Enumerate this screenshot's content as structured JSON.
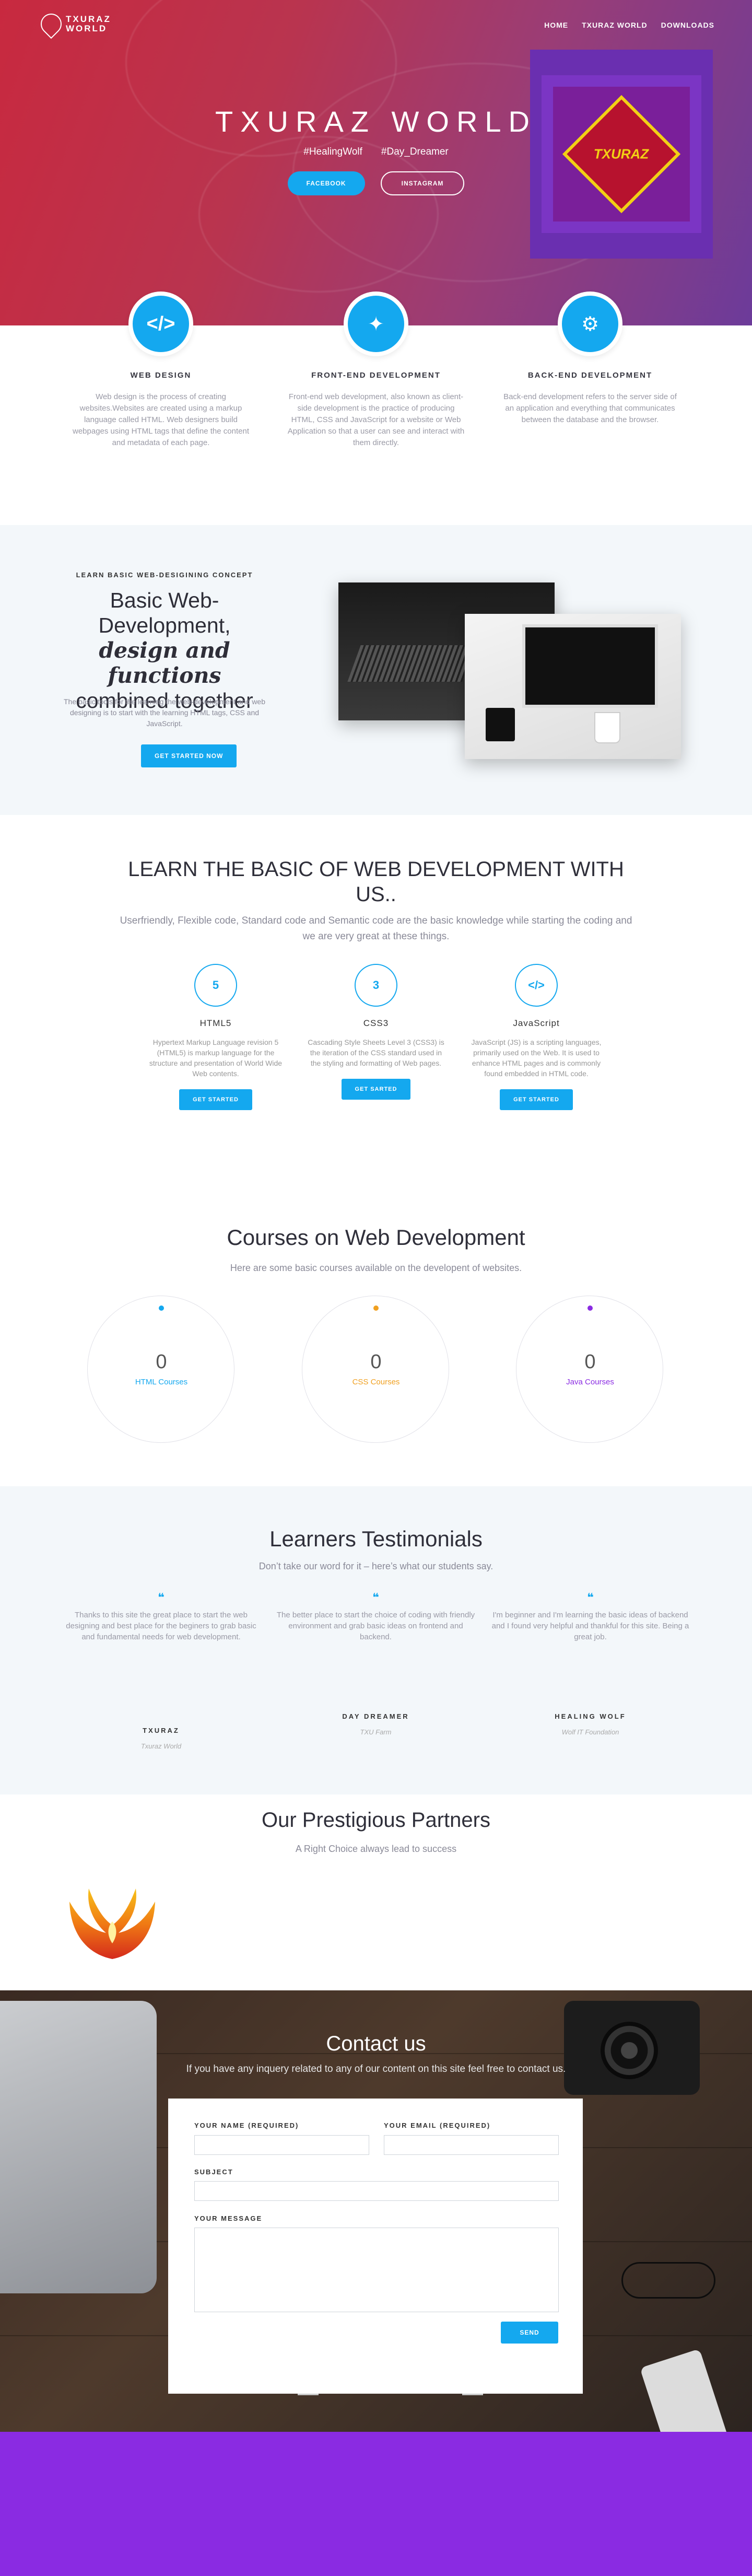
{
  "brand": {
    "name_line1": "TXURAZ",
    "name_line2": "WORLD"
  },
  "nav": [
    "HOME",
    "TXURAZ WORLD",
    "DOWNLOADS"
  ],
  "hero": {
    "title": "TXURAZ WORLD",
    "tags": [
      "#HealingWolf",
      "#Day_Dreamer"
    ],
    "buttons": {
      "facebook": "FACEBOOK",
      "instagram": "INSTAGRAM"
    },
    "badge_text": "TXURAZ"
  },
  "features": [
    {
      "icon": "code-icon",
      "glyph": "</>",
      "title": "WEB DESIGN",
      "text": "Web design is the process of creating websites.Websites are created using a markup language called HTML. Web designers build webpages using HTML tags that define the content and metadata of each page."
    },
    {
      "icon": "magic-wand-icon",
      "glyph": "✦",
      "title": "FRONT-END DEVELOPMENT",
      "text": "Front-end web development, also known as client-side development is the practice of producing HTML, CSS and JavaScript for a website or Web Application so that a user can see and interact with them directly."
    },
    {
      "icon": "gears-icon",
      "glyph": "⚙",
      "title": "BACK-END DEVELOPMENT",
      "text": "Back-end development refers to the server side of an application and everything that communicates between the database and the browser."
    }
  ],
  "learn": {
    "kicker": "LEARN BASIC WEB-DESIGINING CONCEPT",
    "heading_line1": "Basic Web-",
    "heading_line2": "Development,",
    "heading_em": "design and functions",
    "heading_line4": "combined together",
    "text": "The basic tools for the learning the web-development and web designing is to start with the learning HTML tags, CSS and JavaScript.",
    "button": "GET STARTED NOW"
  },
  "basics": {
    "title": "LEARN THE BASIC OF WEB DEVELOPMENT WITH US..",
    "subtitle": "Userfriendly, Flexible code, Standard code and Semantic code are the basic knowledge while starting the coding and we are very great at these things.",
    "items": [
      {
        "icon": "html5-icon",
        "glyph": "5",
        "title": "HTML5",
        "text": "Hypertext Markup Language revision 5 (HTML5) is markup language for the structure and presentation of World Wide Web contents.",
        "button": "GET STARTED"
      },
      {
        "icon": "css3-icon",
        "glyph": "3",
        "title": "CSS3",
        "text": "Cascading Style Sheets Level 3 (CSS3) is the iteration of the CSS standard used in the styling and formatting of Web pages.",
        "button": "GET SARTED"
      },
      {
        "icon": "javascript-icon",
        "glyph": "</>",
        "title": "JavaScript",
        "text": "JavaScript (JS) is a scripting languages, primarily used on the Web. It is used to enhance HTML pages and is commonly found embedded in HTML code.",
        "button": "GET STARTED"
      }
    ]
  },
  "courses": {
    "title": "Courses on Web Development",
    "subtitle": "Here are some basic courses available on the developent of websites.",
    "items": [
      {
        "count": "0",
        "label": "HTML Courses",
        "color": "#14a8ef"
      },
      {
        "count": "0",
        "label": "CSS Courses",
        "color": "#f0a020"
      },
      {
        "count": "0",
        "label": "Java Courses",
        "color": "#8a2be2"
      }
    ]
  },
  "testimonials": {
    "title": "Learners Testimonials",
    "subtitle": "Don’t take our word for it – here’s what our students say.",
    "items": [
      {
        "quote": "Thanks to this site the great place to start the web designing and best place for the beginers to grab basic and fundamental needs for web development.",
        "name": "TXURAZ",
        "role": "Txuraz World"
      },
      {
        "quote": "The better place to start the choice of coding with friendly environment and grab basic ideas on frontend and backend.",
        "name": "DAY DREAMER",
        "role": "TXU Farm"
      },
      {
        "quote": "I'm beginner and I'm learning the basic ideas of backend and I found very helpful and thankful for this site. Being a great job.",
        "name": "HEALING WOLF",
        "role": "Wolf IT Foundation"
      }
    ]
  },
  "partners": {
    "title": "Our Prestigious Partners",
    "subtitle": "A Right Choice always lead to success"
  },
  "contact": {
    "title": "Contact us",
    "subtitle": "If you have any inquery related to any of our content on this site feel free to contact us.",
    "labels": {
      "name": "YOUR NAME (REQUIRED)",
      "email": "YOUR EMAIL (REQUIRED)",
      "subject": "SUBJECT",
      "message": "YOUR MESSAGE"
    },
    "send": "SEND"
  },
  "colors": {
    "accent": "#14a8ef",
    "footer": "#8a2be2",
    "hero_start": "#c8293f",
    "hero_end": "#6c3b9a"
  }
}
